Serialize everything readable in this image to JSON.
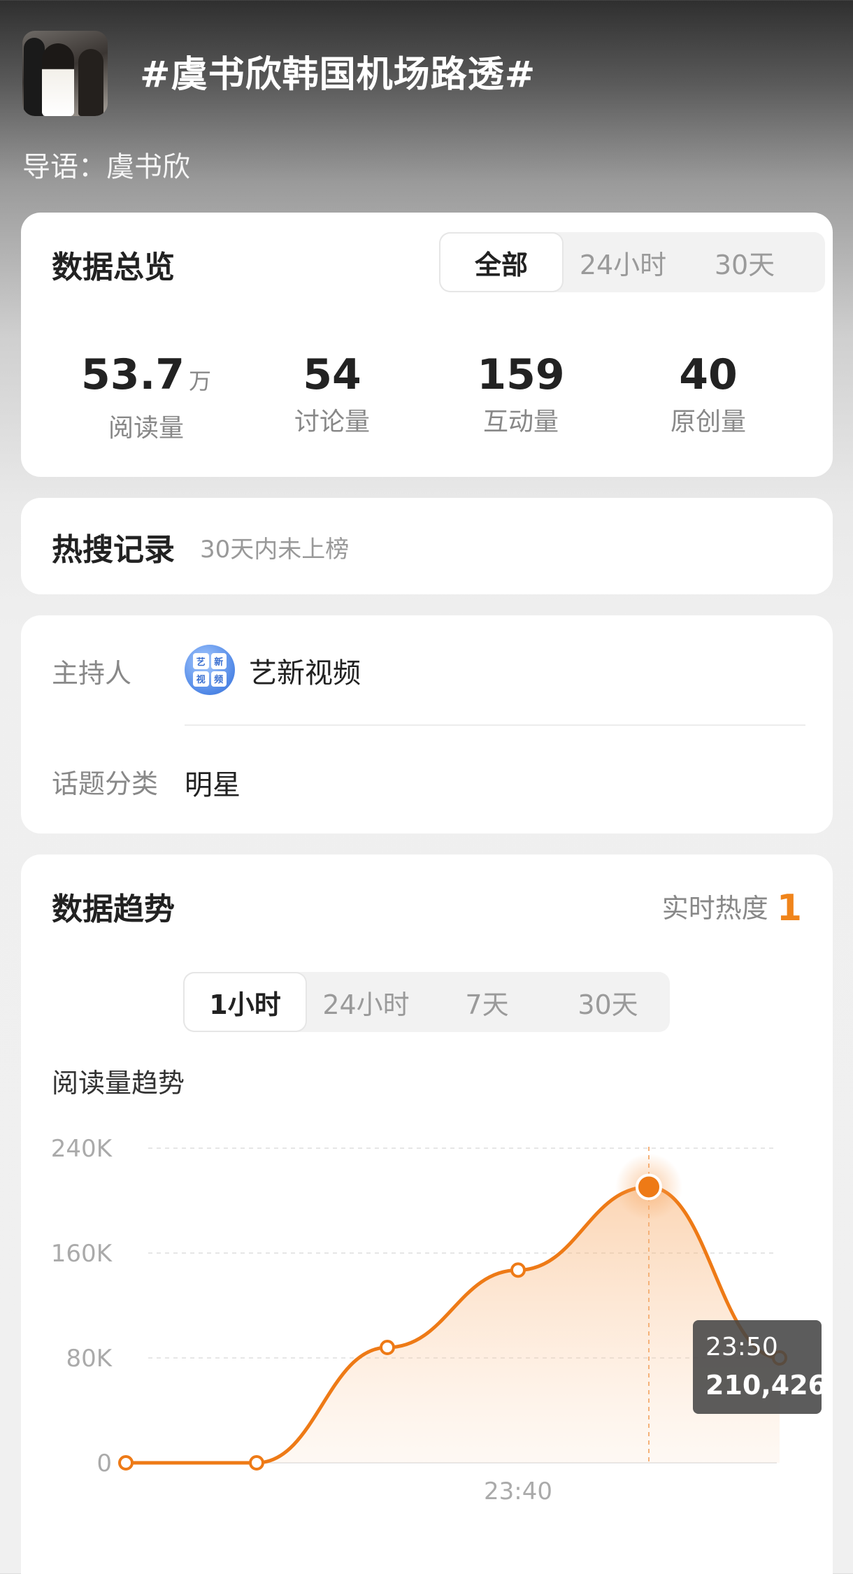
{
  "header": {
    "title": "#虞书欣韩国机场路透#",
    "lead": "导语：虞书欣"
  },
  "overview": {
    "title": "数据总览",
    "tabs": [
      "全部",
      "24小时",
      "30天"
    ],
    "active_tab": "全部",
    "stats": [
      {
        "value": "53.7",
        "unit": "万",
        "label": "阅读量"
      },
      {
        "value": "54",
        "unit": "",
        "label": "讨论量"
      },
      {
        "value": "159",
        "unit": "",
        "label": "互动量"
      },
      {
        "value": "40",
        "unit": "",
        "label": "原创量"
      }
    ]
  },
  "hot_search": {
    "title": "热搜记录",
    "note": "30天内未上榜"
  },
  "info": {
    "host_label": "主持人",
    "host_name": "艺新视频",
    "host_badge_chars": [
      "艺",
      "新",
      "视",
      "频"
    ],
    "category_label": "话题分类",
    "category_value": "明星"
  },
  "trend": {
    "title": "数据趋势",
    "heat_label": "实时热度",
    "heat_value": "1",
    "tabs": [
      "1小时",
      "24小时",
      "7天",
      "30天"
    ],
    "active_tab": "1小时",
    "subtitle": "阅读量趋势",
    "tooltip": {
      "time": "23:50",
      "value": "210,426"
    }
  },
  "colors": {
    "accent": "#f0841a",
    "line": "#ee7a16"
  },
  "chart_data": {
    "type": "area",
    "title": "阅读量趋势",
    "x": [
      0,
      1,
      2,
      3,
      4,
      5
    ],
    "x_tick_labels": [
      {
        "index": 3,
        "label": "23:40"
      }
    ],
    "y_ticks": [
      0,
      80000,
      160000,
      240000
    ],
    "y_tick_labels": [
      "0",
      "80K",
      "160K",
      "240K"
    ],
    "ylim": [
      0,
      240000
    ],
    "series": [
      {
        "values": [
          0,
          0,
          88000,
          147000,
          210426,
          80000
        ]
      }
    ],
    "highlight_index": 4,
    "grid": true
  }
}
